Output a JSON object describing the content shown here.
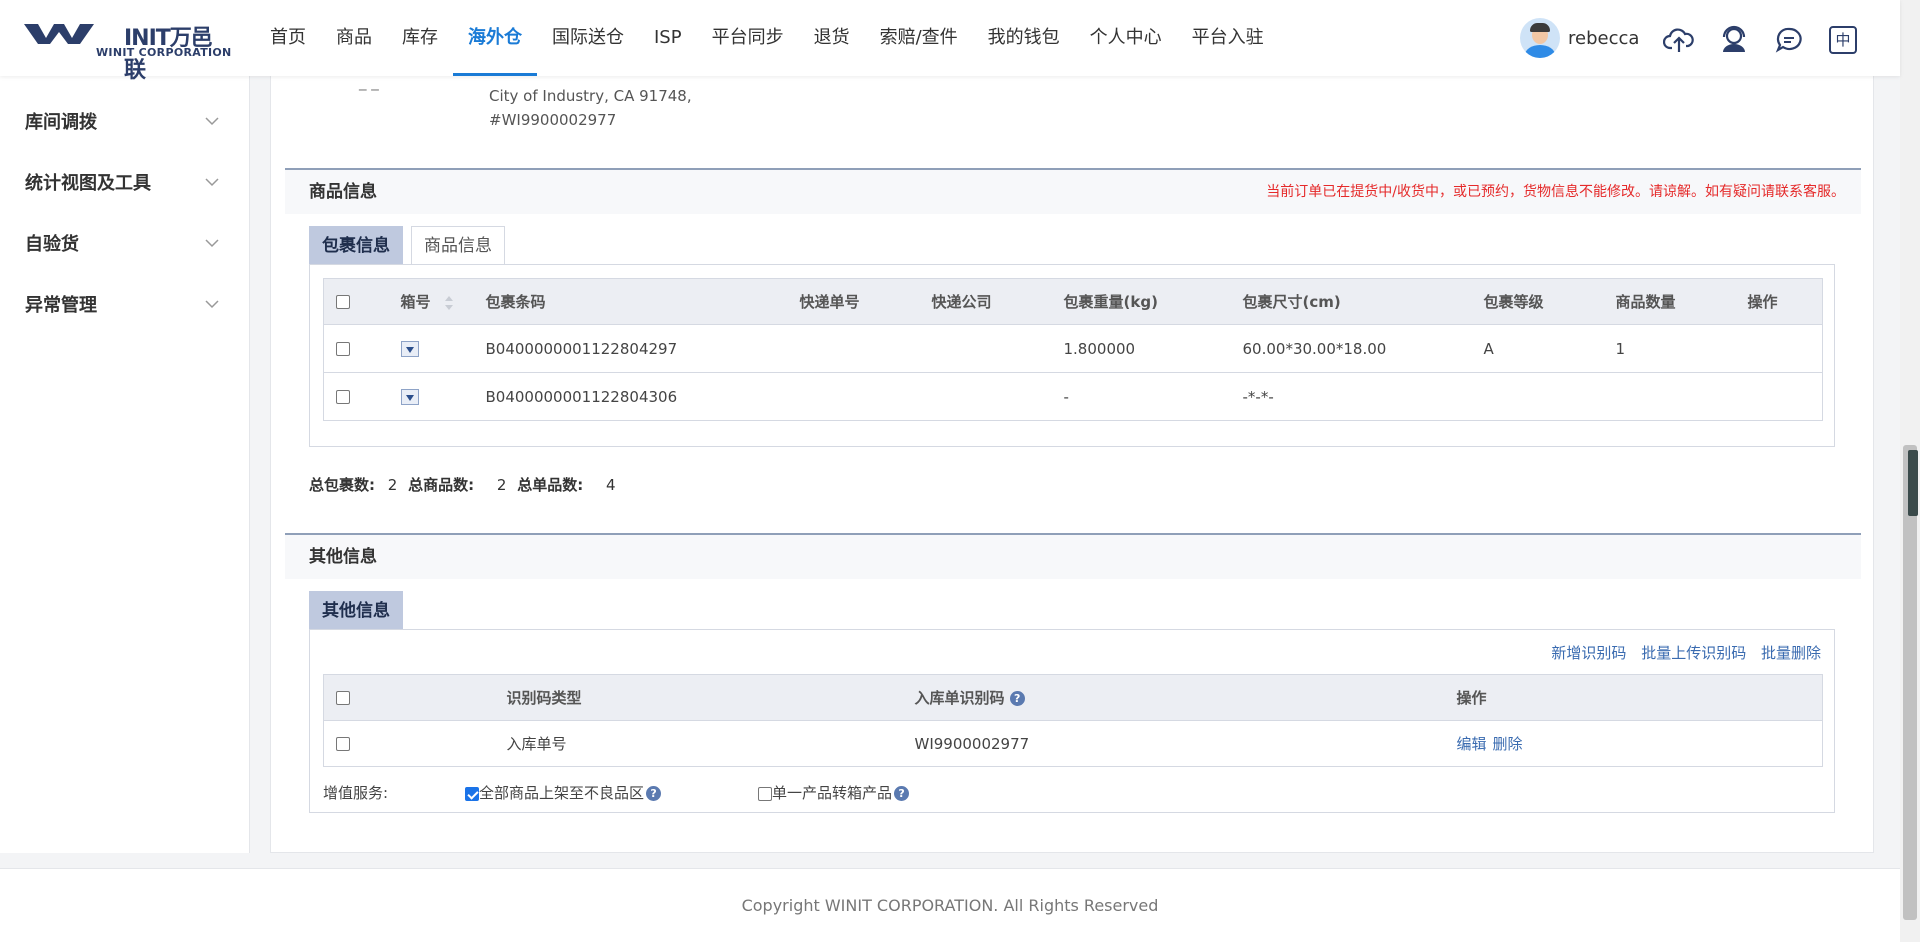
{
  "header": {
    "logo_text": "INIT万邑联",
    "logo_sub": "WINIT CORPORATION",
    "nav": [
      "首页",
      "商品",
      "库存",
      "海外仓",
      "国际送仓",
      "ISP",
      "平台同步",
      "退货",
      "索赔/查件",
      "我的钱包",
      "个人中心",
      "平台入驻"
    ],
    "active_nav": "海外仓",
    "username": "rebecca",
    "lang_icon_label": "中"
  },
  "sidebar": {
    "items": [
      {
        "label": "库间调拨"
      },
      {
        "label": "统计视图及工具"
      },
      {
        "label": "自验货"
      },
      {
        "label": "异常管理"
      }
    ]
  },
  "address": {
    "line1": "City of Industry, CA 91748,",
    "line2": "#WI9900002977",
    "dash": "_ _"
  },
  "goods_section": {
    "title": "商品信息",
    "warning": "当前订单已在提货中/收货中，或已预约，货物信息不能修改。请谅解。如有疑问请联系客服。",
    "tabs": [
      "包裹信息",
      "商品信息"
    ],
    "columns": [
      "箱号",
      "包裹条码",
      "快递单号",
      "快递公司",
      "包裹重量(kg)",
      "包裹尺寸(cm)",
      "包裹等级",
      "商品数量",
      "操作"
    ],
    "rows": [
      {
        "barcode": "B0400000001122804297",
        "tracking": "",
        "carrier": "",
        "weight": "1.800000",
        "size": "60.00*30.00*18.00",
        "grade": "A",
        "qty": "1"
      },
      {
        "barcode": "B0400000001122804306",
        "tracking": "",
        "carrier": "",
        "weight": "-",
        "size": "-*-*-",
        "grade": "",
        "qty": ""
      }
    ],
    "totals": {
      "packages_label": "总包裹数:",
      "packages": "2",
      "goods_label": "总商品数:",
      "goods": "2",
      "units_label": "总单品数:",
      "units": "4"
    }
  },
  "other_section": {
    "title": "其他信息",
    "tab": "其他信息",
    "links": [
      "新增识别码",
      "批量上传识别码",
      "批量删除"
    ],
    "columns": [
      "识别码类型",
      "入库单识别码",
      "操作"
    ],
    "rows": [
      {
        "type": "入库单号",
        "code": "WI9900002977",
        "edit": "编辑",
        "delete": "删除"
      }
    ],
    "vas_label": "增值服务:",
    "vas_option1": "全部商品上架至不良品区",
    "vas_option1_checked": true,
    "vas_option2": "单一产品转箱产品",
    "vas_option2_checked": false
  },
  "footer": {
    "copyright": "Copyright WINIT CORPORATION. All Rights Reserved"
  },
  "colors": {
    "accent": "#1a7bd6",
    "warning": "#e52a2a",
    "tab_active": "#bfc9df",
    "link": "#3a6bb0"
  }
}
